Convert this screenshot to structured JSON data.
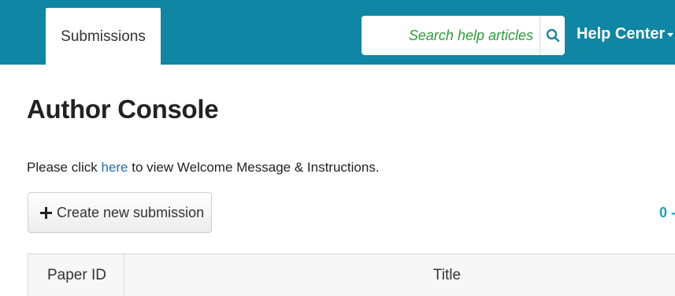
{
  "header": {
    "tab_label": "Submissions",
    "search_placeholder": "Search help articles",
    "help_center_label": "Help Center",
    "brand_color": "#0f86a3"
  },
  "main": {
    "title": "Author Console",
    "welcome": {
      "before": "Please click ",
      "link": "here",
      "after": " to view Welcome Message & Instructions."
    },
    "create_button_label": "Create new submission",
    "pager_text": "0 -"
  },
  "table": {
    "columns": [
      "Paper ID",
      "Title"
    ]
  },
  "icons": {
    "search": "search-icon",
    "plus": "plus-icon",
    "caret": "caret-down-icon"
  }
}
